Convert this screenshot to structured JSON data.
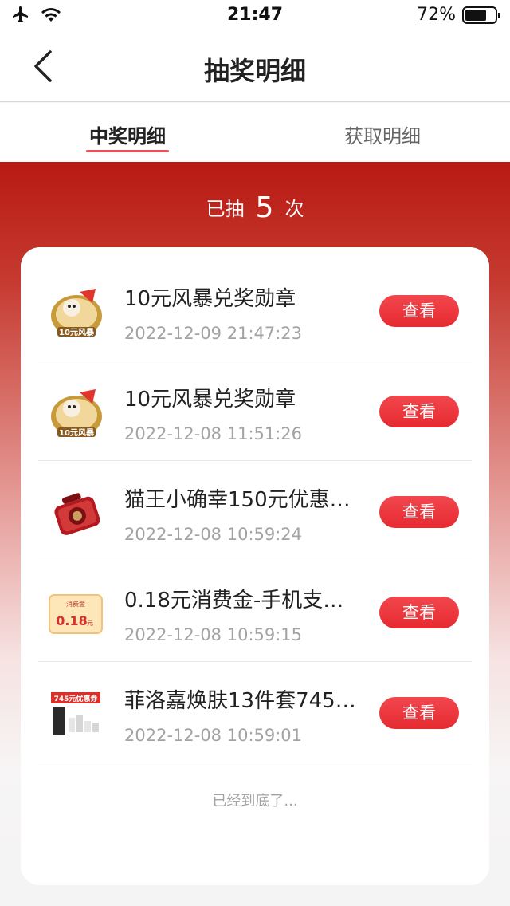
{
  "status": {
    "time": "21:47",
    "battery": "72%",
    "battery_level": 0.72
  },
  "nav": {
    "title": "抽奖明细"
  },
  "tabs": [
    {
      "label": "中奖明细"
    },
    {
      "label": "获取明细"
    }
  ],
  "summary": {
    "prefix": "已抽",
    "count": "5",
    "suffix": "次"
  },
  "records": [
    {
      "title": "10元风暴兑奖勋章",
      "time": "2022-12-09 21:47:23",
      "button": "查看",
      "thumb": "medal-image",
      "thumb_text": "10元风暴"
    },
    {
      "title": "10元风暴兑奖勋章",
      "time": "2022-12-08 11:51:26",
      "button": "查看",
      "thumb": "medal-image",
      "thumb_text": "10元风暴"
    },
    {
      "title": "猫王小确幸150元优惠…",
      "time": "2022-12-08 10:59:24",
      "button": "查看",
      "thumb": "radio-speaker-image"
    },
    {
      "title": "0.18元消费金-手机支…",
      "time": "2022-12-08 10:59:15",
      "button": "查看",
      "thumb": "coupon-image",
      "thumb_label": "消费金",
      "thumb_value": "0.18",
      "thumb_unit": "元"
    },
    {
      "title": "菲洛嘉焕肤13件套745…",
      "time": "2022-12-08 10:59:01",
      "button": "查看",
      "thumb": "skincare-set-image",
      "thumb_banner": "745元优惠券"
    }
  ],
  "footer": {
    "end_text": "已经到底了..."
  },
  "colors": {
    "accent": "#e62a31",
    "header_red": "#b81a12",
    "tab_underline": "#e8535a"
  }
}
